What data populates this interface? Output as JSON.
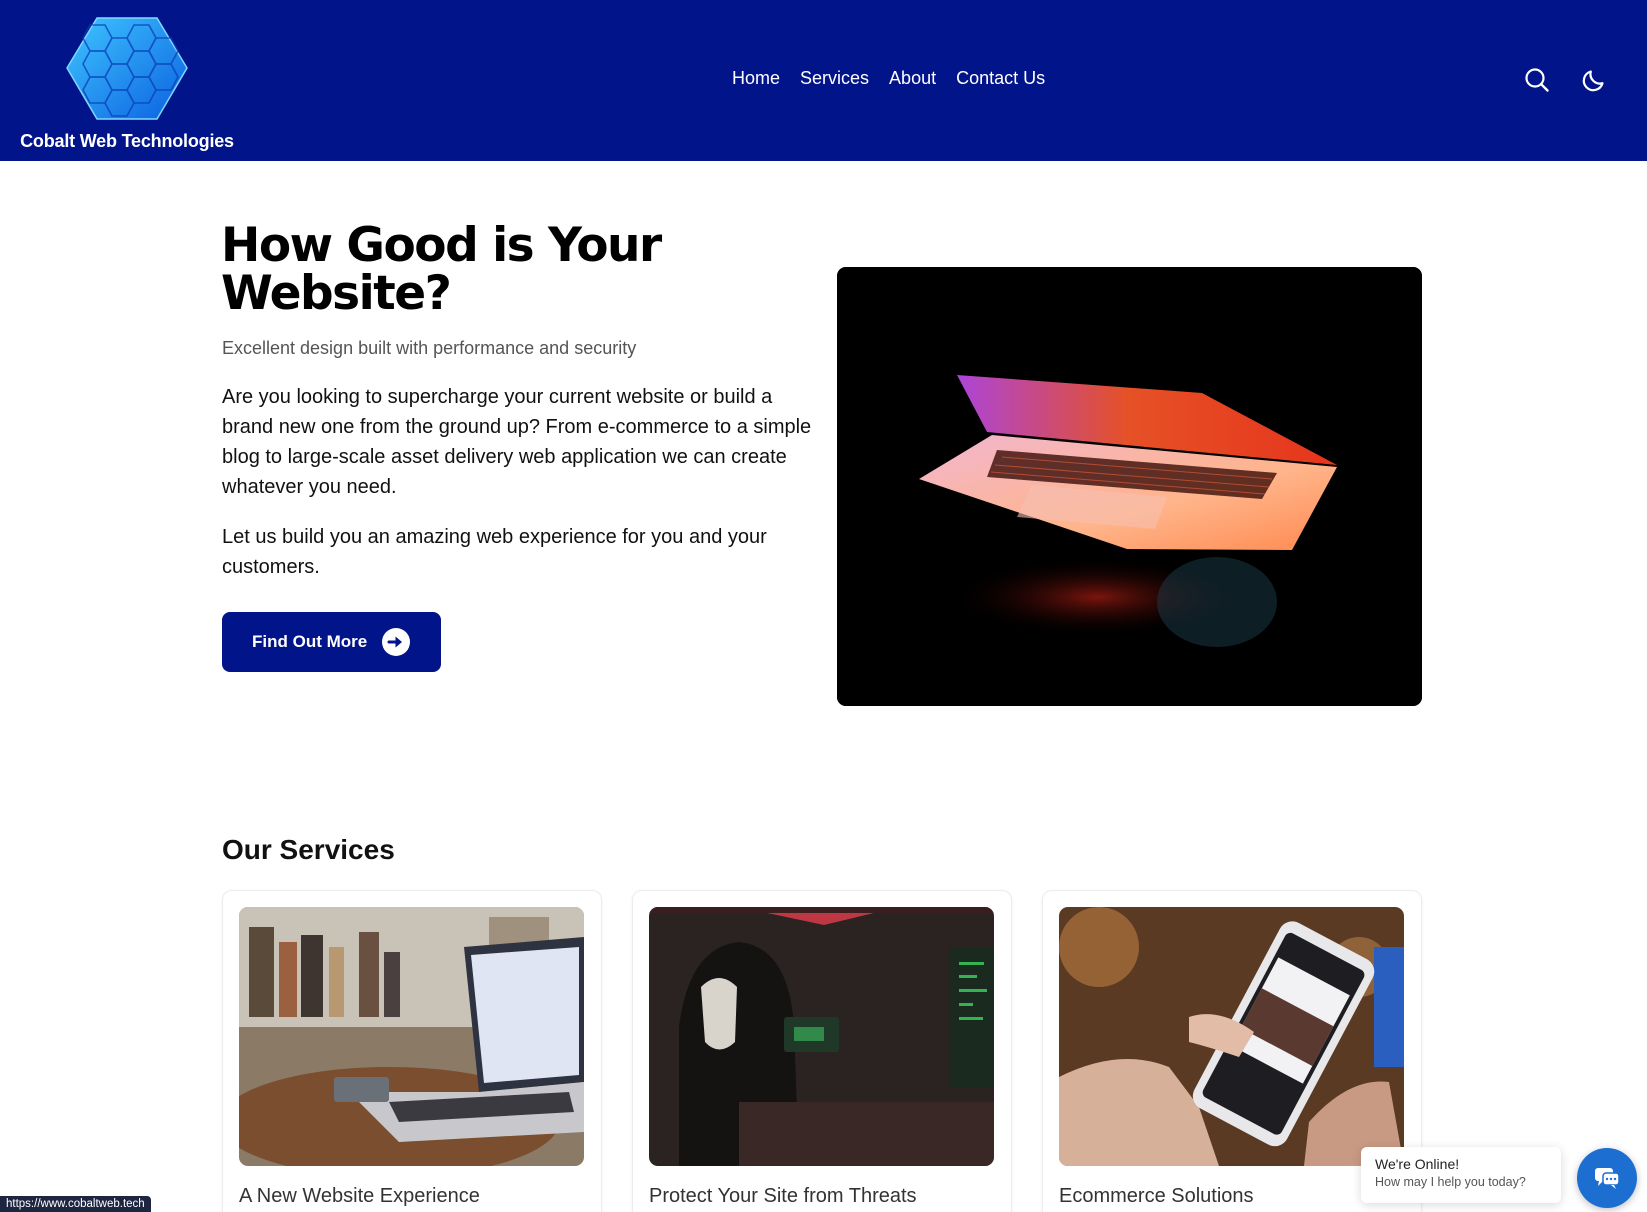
{
  "brand": {
    "name": "Cobalt Web Technologies",
    "logo_icon": "hexagon-logo-icon",
    "header_color": "#02148a"
  },
  "nav": {
    "items": [
      {
        "label": "Home"
      },
      {
        "label": "Services"
      },
      {
        "label": "About"
      },
      {
        "label": "Contact Us"
      }
    ]
  },
  "header_icons": {
    "search": "search-icon",
    "theme_toggle": "moon-icon"
  },
  "hero": {
    "title": "How Good is Your Website?",
    "subtitle": "Excellent design built with performance and security",
    "paragraph1": "Are you looking to supercharge your current website or build a brand new one from the ground up? From e-commerce to a simple blog to large-scale asset delivery web application we can create whatever you need.",
    "paragraph2": "Let us build you an amazing web experience for you and your customers.",
    "cta_label": "Find Out More",
    "cta_icon": "arrow-circle-right-icon",
    "image": "laptop-glow-image"
  },
  "services": {
    "title": "Our Services",
    "cards": [
      {
        "title": "A New Website Experience",
        "image": "laptop-on-table-image"
      },
      {
        "title": "Protect Your Site from Threats",
        "image": "hooded-hacker-image"
      },
      {
        "title": "Ecommerce Solutions",
        "image": "phone-shopping-image"
      }
    ]
  },
  "chat": {
    "status": "We're Online!",
    "prompt": "How may I help you today?",
    "button_icon": "chat-icon",
    "accent": "#1c6fd1"
  },
  "status_bar": {
    "url": "https://www.cobaltweb.tech"
  }
}
